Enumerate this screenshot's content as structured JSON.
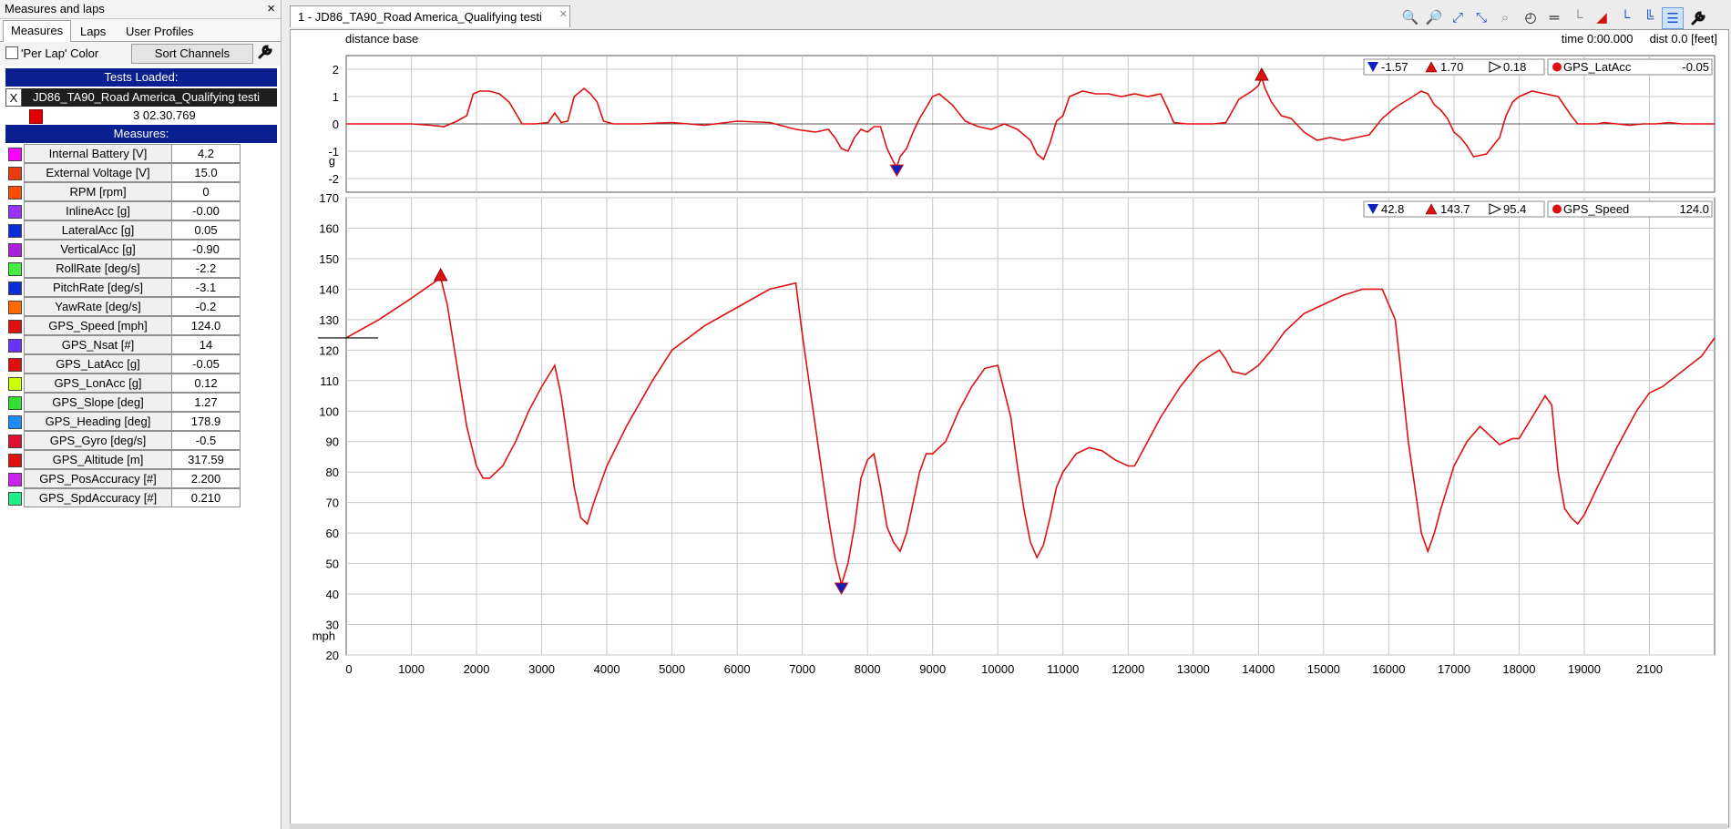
{
  "left_panel": {
    "title": "Measures and laps",
    "close_glyph": "×",
    "tabs": [
      {
        "label": "Measures",
        "active": true
      },
      {
        "label": "Laps",
        "active": false
      },
      {
        "label": "User Profiles",
        "active": false
      }
    ],
    "per_lap_color_label": "'Per Lap' Color",
    "sort_channels_label": "Sort Channels",
    "wrench_icon": "wrench-icon",
    "tests_loaded_header": "Tests Loaded:",
    "test_remove_glyph": "X",
    "test_name": "JD86_TA90_Road America_Qualifying testi",
    "lap_color": "#e00000",
    "lap_time": "3 02.30.769",
    "measures_header": "Measures:",
    "measures": [
      {
        "name": "Internal Battery   [V]",
        "value": "4.2",
        "color": "#ff00ff"
      },
      {
        "name": "External Voltage   [V]",
        "value": "15.0",
        "color": "#e83c0c"
      },
      {
        "name": "RPM   [rpm]",
        "value": "0",
        "color": "#ff4d00"
      },
      {
        "name": "InlineAcc   [g]",
        "value": "-0.00",
        "color": "#9933ff"
      },
      {
        "name": "LateralAcc   [g]",
        "value": "0.05",
        "color": "#0a2ed8"
      },
      {
        "name": "VerticalAcc   [g]",
        "value": "-0.90",
        "color": "#aa22dd"
      },
      {
        "name": "RollRate   [deg/s]",
        "value": "-2.2",
        "color": "#44ee44"
      },
      {
        "name": "PitchRate   [deg/s]",
        "value": "-3.1",
        "color": "#0a2ed8"
      },
      {
        "name": "YawRate   [deg/s]",
        "value": "-0.2",
        "color": "#ff6a00"
      },
      {
        "name": "GPS_Speed   [mph]",
        "value": "124.0",
        "color": "#e01010"
      },
      {
        "name": "GPS_Nsat   [#]",
        "value": "14",
        "color": "#6633ff"
      },
      {
        "name": "GPS_LatAcc   [g]",
        "value": "-0.05",
        "color": "#e01010"
      },
      {
        "name": "GPS_LonAcc   [g]",
        "value": "0.12",
        "color": "#ccff00"
      },
      {
        "name": "GPS_Slope   [deg]",
        "value": "1.27",
        "color": "#33dd33"
      },
      {
        "name": "GPS_Heading   [deg]",
        "value": "178.9",
        "color": "#1e8cff"
      },
      {
        "name": "GPS_Gyro   [deg/s]",
        "value": "-0.5",
        "color": "#e01030"
      },
      {
        "name": "GPS_Altitude   [m]",
        "value": "317.59",
        "color": "#e01010"
      },
      {
        "name": "GPS_PosAccuracy   [#]",
        "value": "2.200",
        "color": "#cc22ee"
      },
      {
        "name": "GPS_SpdAccuracy   [#]",
        "value": "0.210",
        "color": "#22ee88"
      }
    ]
  },
  "graph_tab": {
    "title": "1 - JD86_TA90_Road America_Qualifying testi",
    "close_glyph": "✕"
  },
  "toolbar_icons": [
    "zoom-2d-icon",
    "zoom-in-icon",
    "zoom-x-icon",
    "zoom-y-icon",
    "zoom-reset-icon",
    "clock-icon",
    "dimension-icon",
    "split-icon",
    "color-icon",
    "axis-single-icon",
    "axis-multi-icon",
    "axis-stack-icon",
    "wrench-icon"
  ],
  "graph_header": {
    "base_label": "distance base",
    "time_label": "time 0:00.000",
    "dist_label": "dist 0.0 [feet]"
  },
  "chart_data": [
    {
      "type": "line",
      "channel": "GPS_LatAcc",
      "unit_label": "g",
      "color": "#e01010",
      "xlim": [
        0,
        21000
      ],
      "ylim": [
        -2.5,
        2.5
      ],
      "yticks": [
        2,
        1,
        0,
        -1,
        -2
      ],
      "min_label": "-1.57",
      "max_label": "1.70",
      "avg_label": "0.18",
      "cursor_value": "-0.05",
      "min_x": 8450,
      "max_x": 14050,
      "x": [
        0,
        300,
        600,
        1000,
        1300,
        1500,
        1700,
        1850,
        1950,
        2050,
        2200,
        2350,
        2500,
        2700,
        2900,
        3100,
        3200,
        3300,
        3400,
        3500,
        3650,
        3750,
        3850,
        3950,
        4100,
        4500,
        5000,
        5500,
        6000,
        6500,
        6900,
        7200,
        7400,
        7500,
        7600,
        7700,
        7800,
        7900,
        8000,
        8100,
        8200,
        8300,
        8400,
        8450,
        8500,
        8600,
        8700,
        8800,
        8900,
        9000,
        9100,
        9200,
        9300,
        9500,
        9700,
        9900,
        10100,
        10300,
        10500,
        10600,
        10700,
        10800,
        10900,
        11000,
        11100,
        11300,
        11500,
        11700,
        11900,
        12100,
        12300,
        12500,
        12600,
        12700,
        12900,
        13100,
        13300,
        13500,
        13700,
        13900,
        14000,
        14050,
        14100,
        14200,
        14350,
        14500,
        14700,
        14900,
        15100,
        15300,
        15500,
        15700,
        15900,
        16100,
        16300,
        16500,
        16600,
        16700,
        16800,
        16900,
        17000,
        17100,
        17200,
        17300,
        17500,
        17700,
        17800,
        17900,
        18000,
        18200,
        18400,
        18600,
        18800,
        18900,
        19000,
        19100,
        19200,
        19300,
        19500,
        19700,
        19900,
        20100,
        20300,
        20500,
        20700,
        21000
      ],
      "y": [
        0,
        0,
        0,
        0,
        -0.05,
        -0.1,
        0.1,
        0.3,
        1.1,
        1.2,
        1.2,
        1.1,
        0.8,
        0,
        0,
        0.05,
        0.4,
        0.05,
        0.1,
        1.0,
        1.3,
        1.1,
        0.8,
        0.1,
        0,
        0,
        0.05,
        -0.05,
        0.1,
        0.05,
        -0.2,
        -0.3,
        -0.2,
        -0.5,
        -0.9,
        -1.0,
        -0.5,
        -0.2,
        -0.3,
        -0.1,
        -0.1,
        -0.9,
        -1.4,
        -1.57,
        -1.2,
        -0.9,
        -0.3,
        0.2,
        0.6,
        1.0,
        1.1,
        0.9,
        0.7,
        0.1,
        -0.1,
        -0.2,
        0,
        -0.2,
        -0.6,
        -1.1,
        -1.3,
        -0.7,
        0.1,
        0.3,
        1.0,
        1.2,
        1.1,
        1.1,
        1.0,
        1.1,
        1.0,
        1.1,
        0.6,
        0.05,
        0,
        0,
        0,
        0.05,
        0.9,
        1.2,
        1.4,
        1.7,
        1.3,
        0.8,
        0.3,
        0.2,
        -0.3,
        -0.6,
        -0.5,
        -0.6,
        -0.5,
        -0.4,
        0.2,
        0.6,
        0.9,
        1.2,
        1.1,
        0.7,
        0.5,
        0.2,
        -0.3,
        -0.5,
        -0.8,
        -1.2,
        -1.1,
        -0.5,
        0.3,
        0.8,
        1.0,
        1.2,
        1.1,
        1.0,
        0.3,
        0,
        0,
        0,
        0,
        0.05,
        0,
        -0.05,
        0,
        0,
        0.05,
        0,
        0,
        0
      ]
    },
    {
      "type": "line",
      "channel": "GPS_Speed",
      "unit_label": "mph",
      "color": "#e01010",
      "xlim": [
        0,
        21000
      ],
      "ylim": [
        20,
        170
      ],
      "yticks": [
        170,
        160,
        150,
        140,
        130,
        120,
        110,
        100,
        90,
        80,
        70,
        60,
        50,
        40,
        30,
        20
      ],
      "xticks": [
        0,
        1000,
        2000,
        3000,
        4000,
        5000,
        6000,
        7000,
        8000,
        9000,
        10000,
        11000,
        12000,
        13000,
        14000,
        15000,
        16000,
        17000,
        18000,
        19000,
        20000
      ],
      "xtick_labels": [
        "0",
        "1000",
        "2000",
        "3000",
        "4000",
        "5000",
        "6000",
        "7000",
        "8000",
        "9000",
        "10000",
        "11000",
        "12000",
        "13000",
        "14000",
        "15000",
        "16000",
        "17000",
        "18000",
        "19000",
        "2100"
      ],
      "min_label": "42.8",
      "max_label": "143.7",
      "avg_label": "95.4",
      "cursor_value": "124.0",
      "min_x": 7600,
      "max_x": 1450,
      "x": [
        0,
        500,
        1000,
        1450,
        1550,
        1700,
        1850,
        2000,
        2100,
        2200,
        2400,
        2600,
        2800,
        3000,
        3200,
        3300,
        3400,
        3500,
        3600,
        3700,
        3800,
        4000,
        4300,
        4700,
        5000,
        5500,
        6000,
        6500,
        6900,
        7000,
        7100,
        7200,
        7300,
        7400,
        7500,
        7600,
        7700,
        7800,
        7900,
        8000,
        8100,
        8200,
        8300,
        8400,
        8500,
        8600,
        8700,
        8800,
        8900,
        9000,
        9200,
        9400,
        9600,
        9800,
        10000,
        10200,
        10300,
        10400,
        10500,
        10600,
        10700,
        10800,
        10900,
        11000,
        11200,
        11400,
        11600,
        11800,
        12000,
        12100,
        12300,
        12500,
        12800,
        13100,
        13400,
        13500,
        13600,
        13800,
        14000,
        14200,
        14400,
        14700,
        15000,
        15300,
        15600,
        15900,
        16100,
        16200,
        16300,
        16400,
        16500,
        16600,
        16700,
        16800,
        16900,
        17000,
        17200,
        17400,
        17600,
        17700,
        17800,
        17900,
        18000,
        18200,
        18400,
        18500,
        18600,
        18700,
        18800,
        18900,
        19000,
        19200,
        19500,
        19800,
        20000,
        20200,
        20500,
        20800,
        21000
      ],
      "y": [
        124,
        130,
        137,
        143.7,
        135,
        115,
        95,
        82,
        78,
        78,
        82,
        90,
        100,
        108,
        115,
        105,
        90,
        75,
        65,
        63,
        70,
        82,
        95,
        110,
        120,
        128,
        134,
        140,
        142,
        125,
        110,
        95,
        80,
        65,
        52,
        43,
        50,
        62,
        78,
        84,
        86,
        75,
        62,
        57,
        54,
        60,
        70,
        80,
        86,
        86,
        90,
        100,
        108,
        114,
        115,
        98,
        82,
        68,
        57,
        52,
        56,
        65,
        75,
        80,
        86,
        88,
        87,
        84,
        82,
        82,
        90,
        98,
        108,
        116,
        120,
        117,
        113,
        112,
        115,
        120,
        126,
        132,
        135,
        138,
        140,
        140,
        130,
        110,
        90,
        75,
        60,
        54,
        60,
        68,
        75,
        82,
        90,
        95,
        91,
        89,
        90,
        91,
        91,
        98,
        105,
        102,
        80,
        68,
        65,
        63,
        66,
        75,
        88,
        100,
        106,
        108,
        113,
        118,
        124
      ]
    }
  ]
}
